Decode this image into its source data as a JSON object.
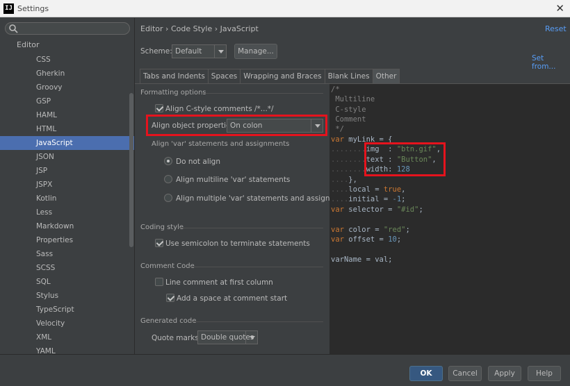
{
  "window": {
    "title": "Settings",
    "app_icon_text": "IJ"
  },
  "left_panel": {
    "search": {
      "value": "",
      "placeholder": ""
    },
    "section": "Editor",
    "items": [
      "CSS",
      "Gherkin",
      "Groovy",
      "GSP",
      "HAML",
      "HTML",
      "JavaScript",
      "JSON",
      "JSP",
      "JSPX",
      "Kotlin",
      "Less",
      "Markdown",
      "Properties",
      "Sass",
      "SCSS",
      "SQL",
      "Stylus",
      "TypeScript",
      "Velocity",
      "XML",
      "YAML"
    ],
    "selected": "JavaScript"
  },
  "header": {
    "breadcrumb": "Editor › Code Style › JavaScript",
    "reset": "Reset",
    "scheme_label": "Scheme:",
    "scheme_value": "Default",
    "manage": "Manage...",
    "set_from": "Set from..."
  },
  "tabs": [
    {
      "label": "Tabs and Indents",
      "active": false
    },
    {
      "label": "Spaces",
      "active": false
    },
    {
      "label": "Wrapping and Braces",
      "active": false
    },
    {
      "label": "Blank Lines",
      "active": false
    },
    {
      "label": "Other",
      "active": true
    }
  ],
  "options": {
    "formatting_title": "Formatting options",
    "align_c_style": {
      "label": "Align C-style comments /*...*/",
      "checked": true
    },
    "align_object_label": "Align object properties:",
    "align_object_value": "On colon",
    "align_var_title": "Align 'var' statements and assignments",
    "radios": [
      {
        "label": "Do not align",
        "checked": true
      },
      {
        "label": "Align multiline 'var' statements",
        "checked": false
      },
      {
        "label": "Align multiple 'var' statements and assignments",
        "checked": false
      }
    ],
    "coding_style_title": "Coding style",
    "use_semicolon": {
      "label": "Use semicolon to terminate statements",
      "checked": true
    },
    "comment_code_title": "Comment Code",
    "line_comment": {
      "label": "Line comment at first column",
      "checked": false
    },
    "add_space": {
      "label": "Add a space at comment start",
      "checked": true
    },
    "generated_code_title": "Generated code",
    "quote_marks_label": "Quote marks:",
    "quote_marks_value": "Double quotes"
  },
  "preview": {
    "comment": [
      "/*",
      " Multiline",
      " C-style",
      " Comment",
      " */"
    ],
    "kw_var": "var",
    "mylink_decl": " myLink = {",
    "img_key": "img  : ",
    "img_val": "\"btn.gif\"",
    "text_key": "text : ",
    "text_val": "\"Button\"",
    "width_key": "width: ",
    "width_val": "128",
    "close_brace": "},",
    "local_key": "local = ",
    "local_val": "true",
    "initial_key": "initial = ",
    "initial_val": "-1",
    "selector_decl": " selector = ",
    "selector_val": "\"#id\"",
    "color_decl": " color = ",
    "color_val": "\"red\"",
    "offset_decl": " offset = ",
    "offset_val": "10",
    "varname_line": "varName = val;",
    "comma": ",",
    "semicolon": ";"
  },
  "buttons": {
    "ok": "OK",
    "cancel": "Cancel",
    "apply": "Apply",
    "help": "Help"
  },
  "colors": {
    "selection": "#4b6eaf",
    "link": "#589df6",
    "highlight_box": "#e5131d"
  }
}
